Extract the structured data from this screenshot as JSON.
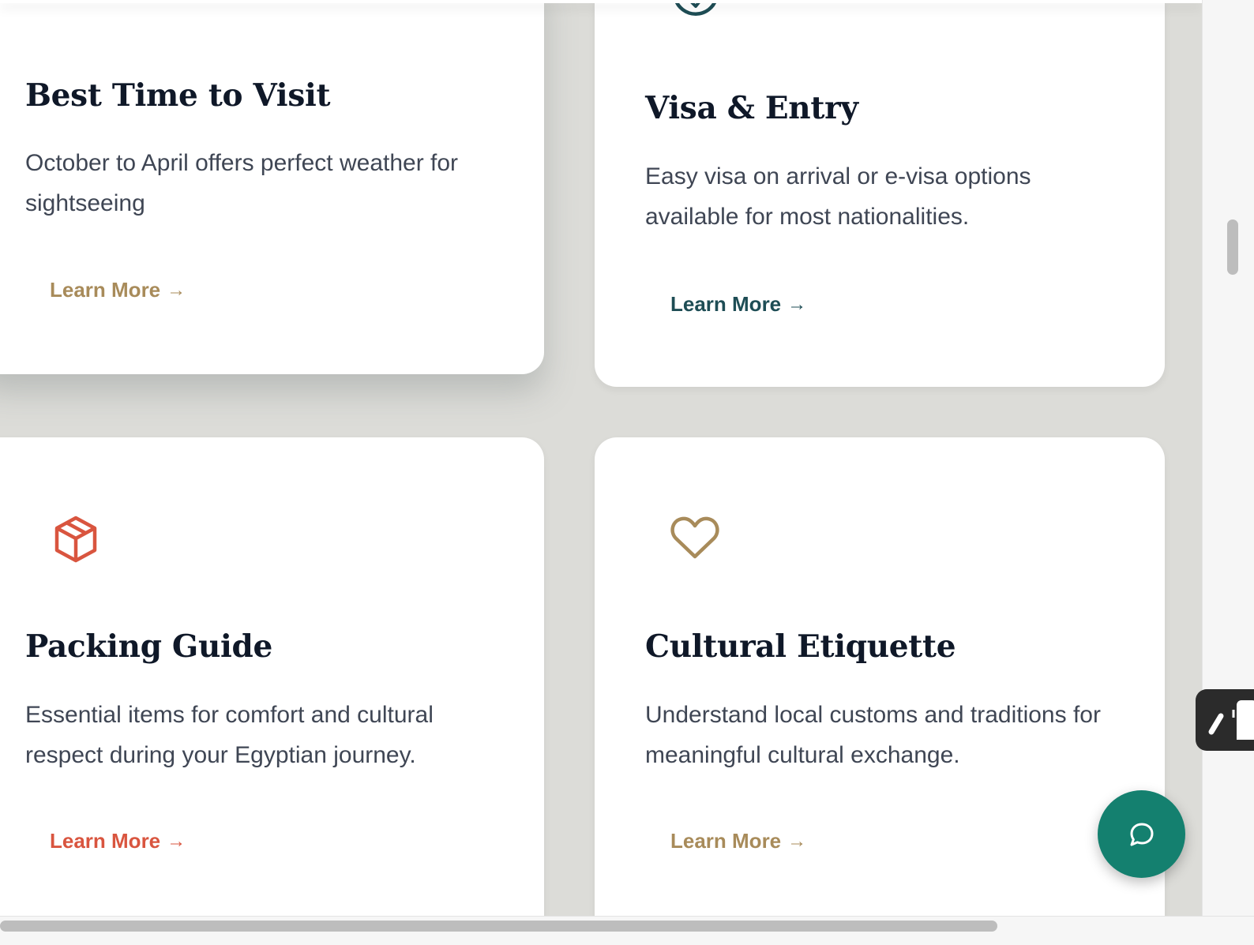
{
  "cards": [
    {
      "title": "Best Time to Visit",
      "description": "October to April offers perfect weather for sightseeing",
      "link_label": "Learn More",
      "link_arrow": "→",
      "icon": "sun-icon",
      "accent": "#a88b5a"
    },
    {
      "title": "Visa & Entry",
      "description": "Easy visa on arrival or e-visa options available for most nationalities.",
      "link_label": "Learn More",
      "link_arrow": "→",
      "icon": "check-circle-icon",
      "accent": "#1e4d55"
    },
    {
      "title": "Packing Guide",
      "description": "Essential items for comfort and cultural respect during your Egyptian journey.",
      "link_label": "Learn More",
      "link_arrow": "→",
      "icon": "package-icon",
      "accent": "#d9553f"
    },
    {
      "title": "Cultural Etiquette",
      "description": "Understand local customs and traditions for meaningful cultural exchange.",
      "link_label": "Learn More",
      "link_arrow": "→",
      "icon": "heart-icon",
      "accent": "#a88b5a"
    }
  ],
  "chat_button": {
    "icon": "chat-bubble-icon",
    "color": "#14806f"
  },
  "side_widget": {
    "icon": "extension-widget-icon"
  }
}
